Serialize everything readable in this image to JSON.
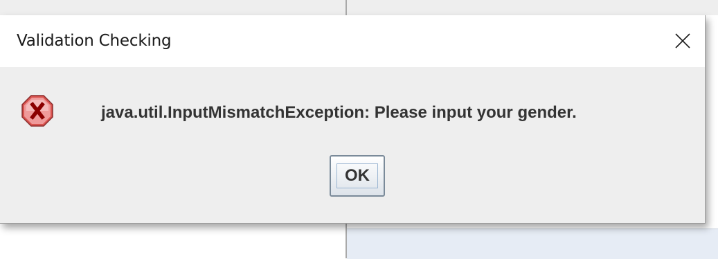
{
  "dialog": {
    "title": "Validation Checking",
    "message": "java.util.InputMismatchException: Please input your gender.",
    "ok_label": "OK",
    "icon": "error-icon",
    "close_icon": "close-icon"
  },
  "colors": {
    "dialog_background": "#eeeeee",
    "titlebar_background": "#ffffff",
    "error_icon_fill": "#e57373",
    "error_icon_glyph": "#8b0000",
    "text": "#333333"
  }
}
